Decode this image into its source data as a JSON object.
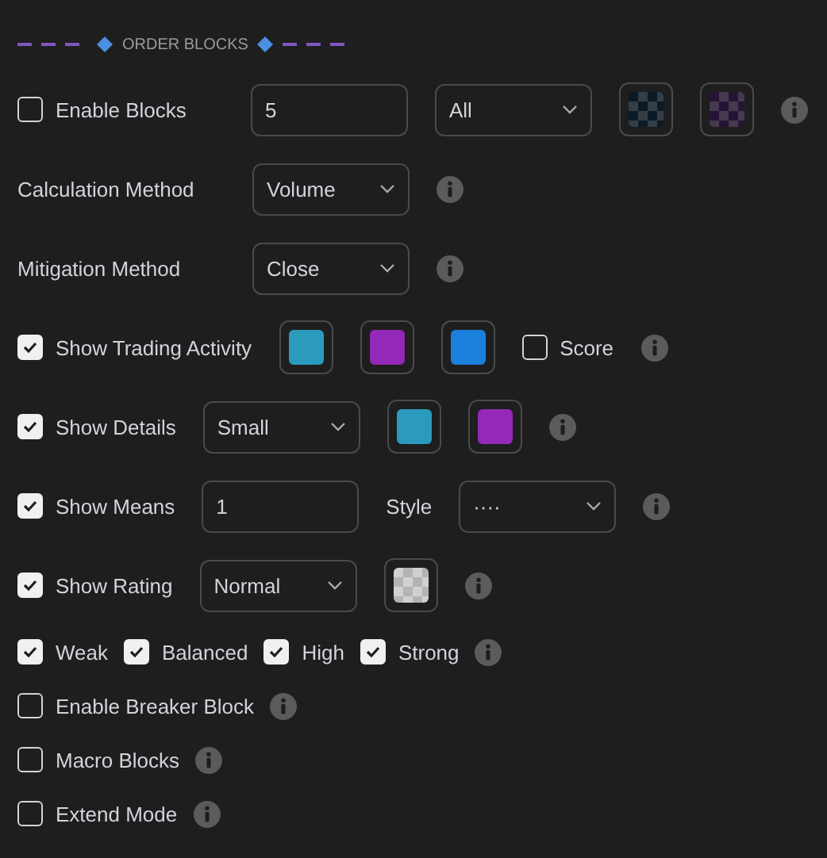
{
  "section": {
    "title": "ORDER BLOCKS"
  },
  "rows": [
    {
      "items": [
        {
          "kind": "checkbox",
          "label": "Enable Blocks",
          "checked": false
        },
        {
          "kind": "input",
          "value": "5"
        },
        {
          "kind": "select",
          "value": "All"
        },
        {
          "kind": "swatch",
          "color": "#0a1a26",
          "checkered": true
        },
        {
          "kind": "swatch",
          "color": "#261436",
          "checkered": true
        },
        {
          "kind": "info"
        }
      ]
    },
    {
      "items": [
        {
          "kind": "label",
          "label": "Calculation Method"
        },
        {
          "kind": "select",
          "value": "Volume"
        },
        {
          "kind": "info"
        }
      ]
    },
    {
      "items": [
        {
          "kind": "label",
          "label": "Mitigation Method"
        },
        {
          "kind": "select",
          "value": "Close"
        },
        {
          "kind": "info"
        }
      ]
    },
    {
      "items": [
        {
          "kind": "checkbox",
          "label": "Show Trading Activity",
          "checked": true
        },
        {
          "kind": "swatch",
          "color": "#2a9bbc",
          "checkered": false
        },
        {
          "kind": "swatch",
          "color": "#9428b8",
          "checkered": false
        },
        {
          "kind": "swatch",
          "color": "#1b7fdc",
          "checkered": false
        },
        {
          "kind": "checkbox",
          "label": "Score",
          "checked": false
        },
        {
          "kind": "info"
        }
      ]
    },
    {
      "items": [
        {
          "kind": "checkbox",
          "label": "Show Details",
          "checked": true
        },
        {
          "kind": "select",
          "value": "Small"
        },
        {
          "kind": "swatch",
          "color": "#2a9bbc",
          "checkered": false
        },
        {
          "kind": "swatch",
          "color": "#9428b8",
          "checkered": false
        },
        {
          "kind": "info"
        }
      ]
    },
    {
      "items": [
        {
          "kind": "checkbox",
          "label": "Show Means",
          "checked": true
        },
        {
          "kind": "input",
          "value": "1"
        },
        {
          "kind": "label",
          "label": "Style"
        },
        {
          "kind": "select",
          "value": "····"
        },
        {
          "kind": "info"
        }
      ]
    },
    {
      "items": [
        {
          "kind": "checkbox",
          "label": "Show Rating",
          "checked": true
        },
        {
          "kind": "select",
          "value": "Normal"
        },
        {
          "kind": "swatch",
          "color": "#d0d0d0",
          "checkered": true
        },
        {
          "kind": "info"
        }
      ]
    },
    {
      "items": [
        {
          "kind": "checkbox",
          "label": "Weak",
          "checked": true
        },
        {
          "kind": "checkbox",
          "label": "Balanced",
          "checked": true
        },
        {
          "kind": "checkbox",
          "label": "High",
          "checked": true
        },
        {
          "kind": "checkbox",
          "label": "Strong",
          "checked": true
        },
        {
          "kind": "info"
        }
      ]
    },
    {
      "items": [
        {
          "kind": "checkbox",
          "label": "Enable Breaker Block",
          "checked": false
        },
        {
          "kind": "info"
        }
      ]
    },
    {
      "items": [
        {
          "kind": "checkbox",
          "label": "Macro Blocks",
          "checked": false
        },
        {
          "kind": "info"
        }
      ]
    },
    {
      "items": [
        {
          "kind": "checkbox",
          "label": "Extend Mode",
          "checked": false
        },
        {
          "kind": "info"
        }
      ]
    }
  ]
}
